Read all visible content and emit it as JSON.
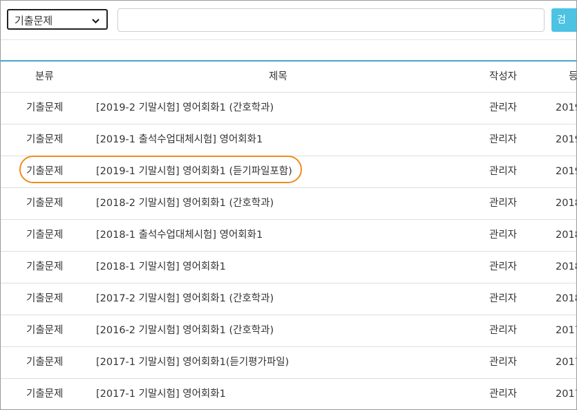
{
  "toolbar": {
    "category_select": "기출문제",
    "search_value": "",
    "button_label": "검"
  },
  "table": {
    "headers": {
      "category": "분류",
      "title": "제목",
      "author": "작성자",
      "date": "등"
    },
    "rows": [
      {
        "category": "기출문제",
        "title": "[2019-2 기말시험] 영어회화1 (간호학과)",
        "author": "관리자",
        "date": "2019"
      },
      {
        "category": "기출문제",
        "title": "[2019-1 출석수업대체시험] 영어회화1",
        "author": "관리자",
        "date": "2019"
      },
      {
        "category": "기출문제",
        "title": "[2019-1 기말시험] 영어회화1 (듣기파일포함)",
        "author": "관리자",
        "date": "2019"
      },
      {
        "category": "기출문제",
        "title": "[2018-2 기말시험] 영어회화1 (간호학과)",
        "author": "관리자",
        "date": "2018"
      },
      {
        "category": "기출문제",
        "title": "[2018-1 출석수업대체시험] 영어회화1",
        "author": "관리자",
        "date": "2018"
      },
      {
        "category": "기출문제",
        "title": "[2018-1 기말시험] 영어회화1",
        "author": "관리자",
        "date": "2018"
      },
      {
        "category": "기출문제",
        "title": "[2017-2 기말시험] 영어회화1 (간호학과)",
        "author": "관리자",
        "date": "2018"
      },
      {
        "category": "기출문제",
        "title": "[2016-2 기말시험] 영어회화1 (간호학과)",
        "author": "관리자",
        "date": "2017"
      },
      {
        "category": "기출문제",
        "title": "[2017-1 기말시험] 영어회화1(듣기평가파일)",
        "author": "관리자",
        "date": "2017"
      },
      {
        "category": "기출문제",
        "title": "[2017-1 기말시험] 영어회화1",
        "author": "관리자",
        "date": "2017"
      }
    ]
  },
  "colors": {
    "accent": "#45a7c9",
    "button": "#4cc3e3",
    "highlight": "#f08c1e"
  },
  "icons": {
    "dropdown": "chevron-down-icon"
  }
}
